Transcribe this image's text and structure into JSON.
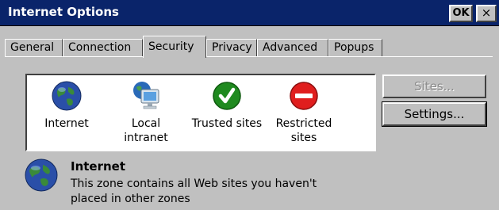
{
  "window": {
    "title": "Internet Options",
    "ok_label": "OK",
    "close_label": "×"
  },
  "tabs": [
    {
      "label": "General",
      "active": false
    },
    {
      "label": "Connection",
      "active": false
    },
    {
      "label": "Security",
      "active": true
    },
    {
      "label": "Privacy",
      "active": false
    },
    {
      "label": "Advanced",
      "active": false
    },
    {
      "label": "Popups",
      "active": false
    }
  ],
  "zones": [
    {
      "label_line1": "Internet",
      "label_line2": "",
      "icon": "globe-icon"
    },
    {
      "label_line1": "Local",
      "label_line2": "intranet",
      "icon": "computer-globe-icon"
    },
    {
      "label_line1": "Trusted sites",
      "label_line2": "",
      "icon": "checkmark-icon",
      "color": "#1f8a1f"
    },
    {
      "label_line1": "Restricted",
      "label_line2": "sites",
      "icon": "no-entry-icon",
      "color": "#e01e1e"
    }
  ],
  "buttons": {
    "sites_label": "Sites...",
    "sites_enabled": false,
    "settings_label": "Settings..."
  },
  "selected_zone": {
    "name": "Internet",
    "description_line1": "This zone contains all Web sites you haven't",
    "description_line2": "placed in other zones",
    "icon": "globe-icon"
  },
  "colors": {
    "titlebar": "#0a246a",
    "face": "#c0c0c0"
  }
}
